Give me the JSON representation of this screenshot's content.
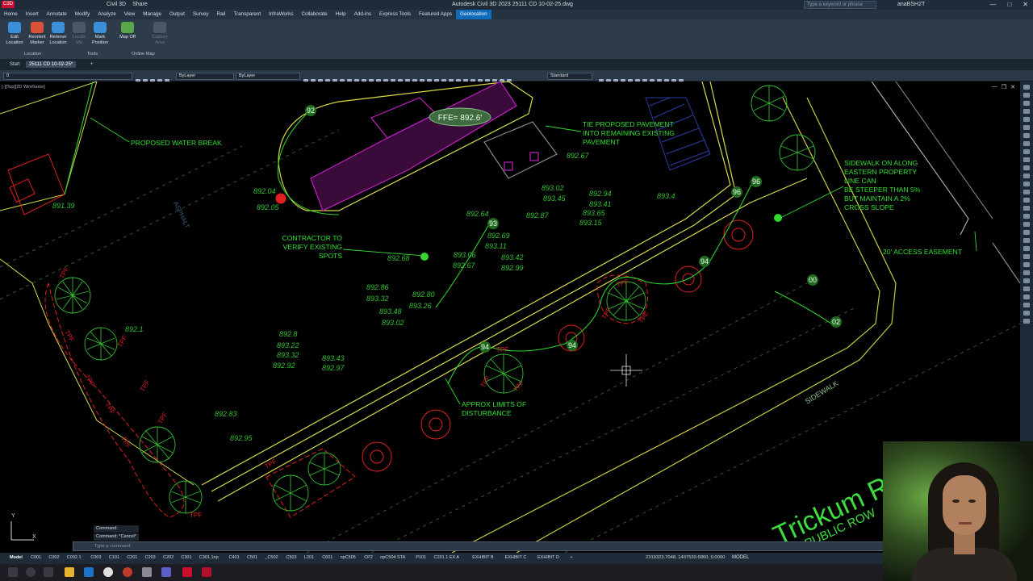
{
  "app": {
    "product": "Civil 3D",
    "share_label": "Share",
    "title": "Autodesk Civil 3D 2023   25111 CD 10-02-25.dwg",
    "search_placeholder": "Type a keyword or phrase",
    "user": "anaBSH2T",
    "app_icon_text": "C3D"
  },
  "menu": {
    "tabs": [
      "Home",
      "Insert",
      "Annotate",
      "Modify",
      "Analyze",
      "View",
      "Manage",
      "Output",
      "Survey",
      "Rail",
      "Transparent",
      "InfraWorks",
      "Collaborate",
      "Help",
      "Add-ins",
      "Express Tools",
      "Featured Apps",
      "Geolocation"
    ],
    "active": "Geolocation"
  },
  "ribbon": {
    "buttons": [
      {
        "label": "Edit Location",
        "icon": "globe-edit-icon",
        "enabled": true
      },
      {
        "label": "Reorient Marker",
        "icon": "marker-icon",
        "enabled": true
      },
      {
        "label": "Remove Location",
        "icon": "globe-remove-icon",
        "enabled": true
      },
      {
        "label": "Locate Me",
        "icon": "locate-icon",
        "enabled": false
      },
      {
        "label": "Mark Position",
        "icon": "mark-position-icon",
        "enabled": true
      },
      {
        "label": "Map Off",
        "icon": "map-icon",
        "enabled": true
      },
      {
        "label": "Capture Area",
        "icon": "capture-icon",
        "enabled": false
      }
    ],
    "panels": [
      "Location",
      "Tools",
      "Online Map"
    ]
  },
  "doc_tabs": {
    "start": "Start",
    "active": "25111 CD 10-02-25*"
  },
  "properties": {
    "layer": "0",
    "color": "ByLayer",
    "linetype": "ByLayer",
    "style": "Standard"
  },
  "viewport": {
    "label": "[-][Top][2D Wireframe]",
    "annotations": {
      "water_break": "PROPOSED WATER BREAK",
      "tie_pavement": [
        "TIE PROPOSED PAVEMENT",
        "INTO REMAINING EXISTING",
        "PAVEMENT"
      ],
      "sidewalk": [
        "SIDEWALK ON ALONG",
        "EASTERN PROPERTY",
        "LINE CAN",
        "BE STEEPER THAN 5%",
        "BUT MAINTAIN A 2%",
        "CROSS SLOPE"
      ],
      "contractor": [
        "CONTRACTOR TO",
        "VERIFY EXISTING",
        "SPOTS"
      ],
      "access_easement": "20' ACCESS EASEMENT",
      "disturbance": [
        "APPROX LIMITS OF",
        "DISTURBANCE"
      ],
      "ffe": "FFE= 892.6'",
      "asphalt": "ASPHALT",
      "sidewalk_label": "SIDEWALK",
      "street_name": "Trickum R",
      "row_label": "PUBLIC ROW"
    },
    "contour_labels": [
      "92",
      "93",
      "94",
      "94",
      "94",
      "96",
      "96",
      "00",
      "02"
    ],
    "spot_elevations": [
      "892.04",
      "892.05",
      "891.39",
      "892.64",
      "892.69",
      "893.11",
      "892.68",
      "893.06",
      "892.67",
      "893.42",
      "892.99",
      "892.86",
      "893.32",
      "892.80",
      "893.26",
      "893.48",
      "893.02",
      "892.1",
      "892.8",
      "893.22",
      "893.32",
      "892.92",
      "893.43",
      "892.97",
      "892.83",
      "892.95",
      "893.02",
      "893.45",
      "892.87",
      "892.94",
      "893.41",
      "893.65",
      "893.15",
      "892.67",
      "893.4"
    ],
    "tree_tag": "TPF"
  },
  "command": {
    "history": [
      "Command:",
      "Command: *Cancel*"
    ],
    "placeholder": "Type a command"
  },
  "layouts": {
    "tabs": [
      "Model",
      "C001",
      "C002",
      "C002.1",
      "C003",
      "C101",
      "C201",
      "C203",
      "C202",
      "C301",
      "C301.1np",
      "C401",
      "C501",
      "_C502",
      "C503",
      "L201",
      "C601",
      "npC505",
      "CP2",
      "npC504 STA",
      "P101",
      "C201.1 EX A",
      "EXHIBIT B",
      "EXHIBIT C",
      "EXHIBIT D"
    ],
    "active": "Model",
    "add": "+"
  },
  "status": {
    "coords": "2319323.7048, 1407530.6860, 0.0000",
    "mode": "MODEL"
  },
  "colors": {
    "cad_green": "#33d633",
    "cad_yellow": "#d9d94a",
    "cad_magenta": "#c020c0",
    "cad_red": "#e02020",
    "cad_cyan": "#6ad0d0",
    "accent": "#0f6cbd"
  }
}
